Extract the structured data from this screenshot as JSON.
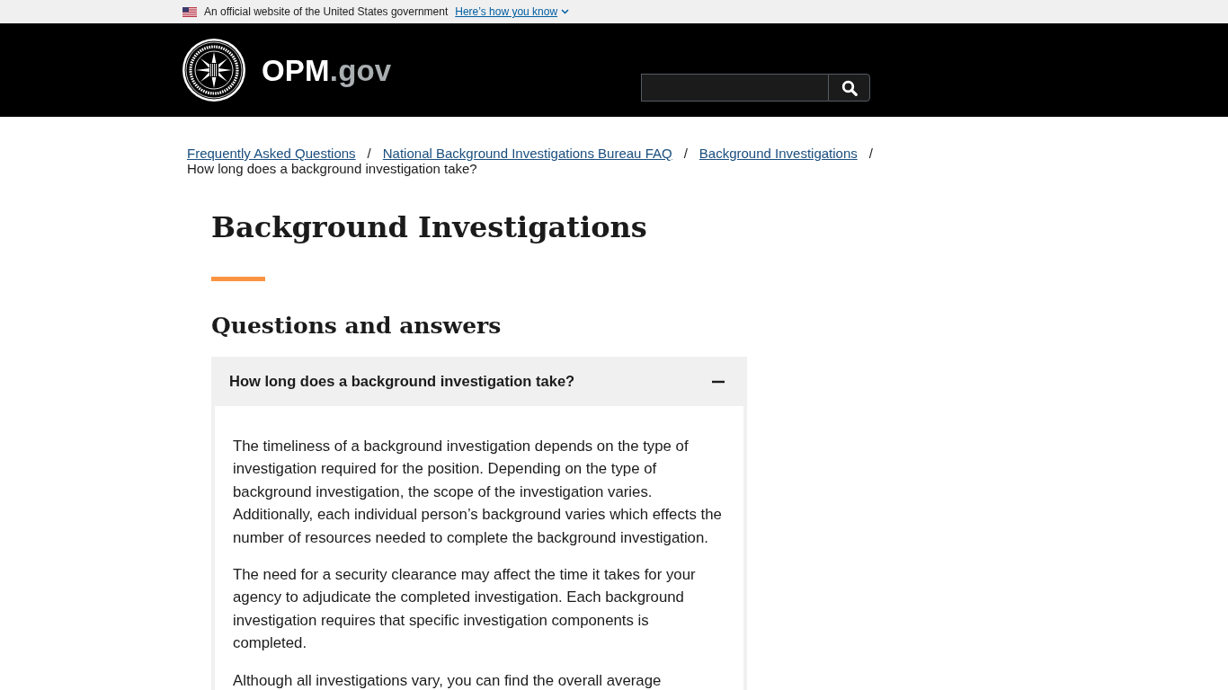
{
  "gov_banner": {
    "text": "An official website of the United States government",
    "link": "Here’s how you know",
    "expanded": false
  },
  "site": {
    "name": "OPM",
    "suffix": ".gov"
  },
  "breadcrumbs": [
    {
      "label": "Frequently Asked Questions",
      "kind": "link",
      "separator": "/"
    },
    {
      "label": "National Background Investigations Bureau FAQ",
      "kind": "link",
      "separator": "/"
    },
    {
      "label": "Background Investigations",
      "kind": "link",
      "separator": "/"
    },
    {
      "label": "How long does a background investigation take?",
      "kind": "current"
    }
  ],
  "page_title": "Background Investigations",
  "section_heading": "Questions and answers",
  "accordion": [
    {
      "question": "How long does a background investigation take?",
      "expanded": true,
      "paragraphs": [
        "The timeliness of a background investigation depends on the type of investigation required for the position. Depending on the type of background investigation, the scope of the investigation varies. Additionally, each individual person’s background varies which effects the number of resources needed to complete the background investigation.",
        "The need for a security clearance may affect the time it takes for your agency to adjudicate the completed investigation. Each background investigation requires that specific investigation components is completed.",
        "Although all investigations vary, you can find the overall average"
      ]
    }
  ]
}
